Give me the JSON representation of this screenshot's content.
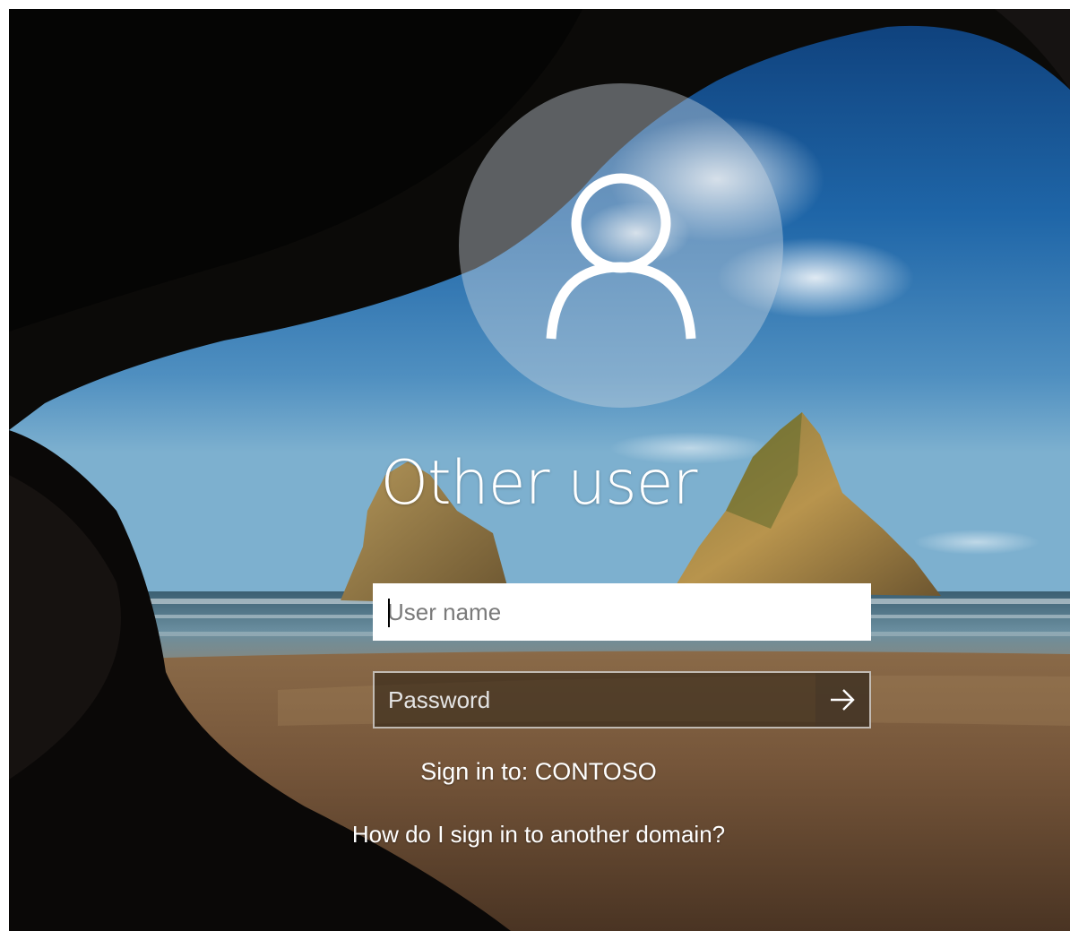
{
  "login": {
    "user_title": "Other user",
    "username_placeholder": "User name",
    "password_placeholder": "Password",
    "signin_domain_text": "Sign in to: CONTOSO",
    "other_domain_link": "How do I sign in to another domain?"
  },
  "icons": {
    "avatar": "user-silhouette-icon",
    "submit": "arrow-right-icon"
  },
  "colors": {
    "text": "#ffffff",
    "username_field_bg": "#ffffff",
    "password_field_bg": "#2a1f14"
  }
}
